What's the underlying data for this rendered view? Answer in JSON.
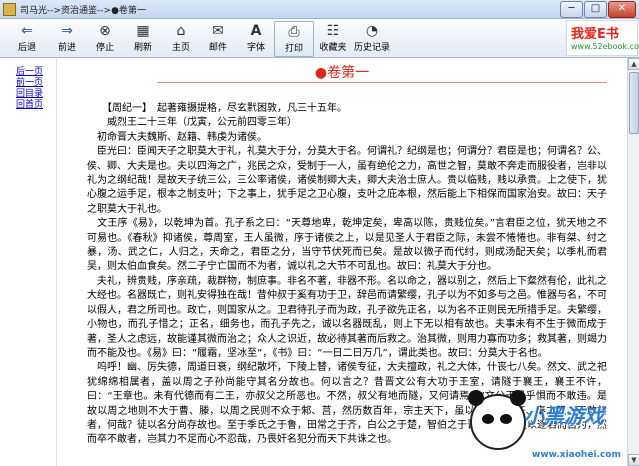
{
  "window": {
    "title": "司马光-->资治通鉴-->●卷第一",
    "minimize": "─",
    "maximize": "□",
    "close": "✕"
  },
  "toolbar": {
    "items": [
      {
        "label": "后退",
        "icon": "back-arrow-icon",
        "glyph": "⇐"
      },
      {
        "label": "前进",
        "icon": "forward-arrow-icon",
        "glyph": "⇒"
      },
      {
        "label": "停止",
        "icon": "stop-icon",
        "glyph": "⊗"
      },
      {
        "label": "刷新",
        "icon": "refresh-icon",
        "glyph": "▦"
      },
      {
        "label": "主页",
        "icon": "home-icon",
        "glyph": "⌂"
      },
      {
        "label": "邮件",
        "icon": "mail-icon",
        "glyph": "✉"
      },
      {
        "label": "字体",
        "icon": "font-icon",
        "glyph": "A"
      },
      {
        "label": "打印",
        "icon": "print-icon",
        "glyph": "⎙"
      },
      {
        "label": "收藏夹",
        "icon": "favorites-icon",
        "glyph": "☷"
      },
      {
        "label": "历史记录",
        "icon": "history-icon",
        "glyph": "◔"
      }
    ]
  },
  "logo": {
    "main": "我爱E书",
    "url": "www.52ebook.com"
  },
  "sidebar": {
    "links": [
      "后一页",
      "前一页",
      "回目录",
      "回首页"
    ]
  },
  "chapter": {
    "title": "●卷第一"
  },
  "paragraphs": [
    "　　【周纪一】　起著雍摄提格，尽玄黓困敦，凡三十五年。",
    "　　威烈王二十三年（戊寅，公元前四零三年）",
    "　初命晋大夫魏斯、赵籍、韩虔为诸侯。",
    "　臣光曰：臣闻天子之职莫大于礼，礼莫大于分，分莫大于名。何谓礼？纪纲是也；何谓分？君臣是也；何谓名？公、侯、卿、大夫是也。夫以四海之广，兆民之众，受制于一人，虽有绝伦之力，高世之智，莫敢不奔走而服役者，岂非以礼为之纲纪哉！是故天子统三公，三公率诸侯，诸侯制卿大夫，卿大夫治士庶人。贵以临贱，贱以承贵。上之使下，犹心腹之运手足，根本之制支叶；下之事上，犹手足之卫心腹，支叶之庇本根，然后能上下相保而国家治安。故曰：天子之职莫大于礼也。",
    "　文王序《易》，以乾坤为首。孔子系之曰：“天尊地卑，乾坤定矣，卑高以陈，贵贱位矣。”言君臣之位，犹天地之不可易也。《春秋》抑诸侯，尊周室，王人虽微，序于诸侯之上，以是见圣人于君臣之际，未尝不惓惓也。非有桀、纣之暴，汤、武之仁，人归之，天命之，君臣之分，当守节伏死而已矣。是故以微子而代纣，则成汤配天矣；以季札而君吴，则太伯血食矣。然二子宁亡国而不为者，诚以礼之大节不可乱也。故曰：礼莫大于分也。",
    "　夫礼，辨贵贱，序亲疏，裁群物，制庶事。非名不著，非器不形。名以命之，器以别之，然后上下粲然有伦，此礼之大经也。名器既亡，则礼安得独在哉！昔仲叔于奚有功于卫，辞邑而请繁缨，孔子以为不如多与之邑。惟器与名，不可以假人，君之所司也。政亡，则国家从之。卫君待孔子而为政，孔子欲先正名，以为名不正则民无所措手足。夫繁缨，小物也，而孔子惜之；正名，细务也，而孔子先之，诚以名器既乱，则上下无以相有故也。夫事未有不生于微而成于著，圣人之虑远，故能谨其微而治之；众人之识近，故必待其著而后救之。治其微，则用力寡而功多；救其著，则竭力而不能及也。《易》曰：“履霜，坚冰至”，《书》曰：“一日二日万几”，谓此类也。故曰：分莫大于名也。",
    "　呜呼！幽、厉失德，周道日衰，纲纪散坏，下陵上替，诸侯专征，大夫擅政，礼之大体，什丧七八矣。然文、武之祀犹绵绵相属者，盖以周之子孙尚能守其名分故也。何以言之？昔晋文公有大功于王室，请隧于襄王，襄王不许，曰：“王章也。未有代德而有二王，亦叔父之所恶也。不然，叔父有地而隧，又何请焉！”文公于是乎惧而不敢违。是故以周之地则不大于曹、滕，以周之民则不众于邾、莒，然历数百年，宗主天下，虽以晋、楚、齐、秦之强，不敢加者，何哉？徒以名分尚存故也。至于季氏之于鲁，田常之于齐，白公之于楚，智伯之于晋，其势皆足以逐君而自为，然而卒不敢者，岂其力不足而心不忍哉，乃畏奸名犯分而天下共诛之也。"
  ],
  "watermark": {
    "title": "小黑游戏",
    "url": "www.xiaohei.com"
  }
}
